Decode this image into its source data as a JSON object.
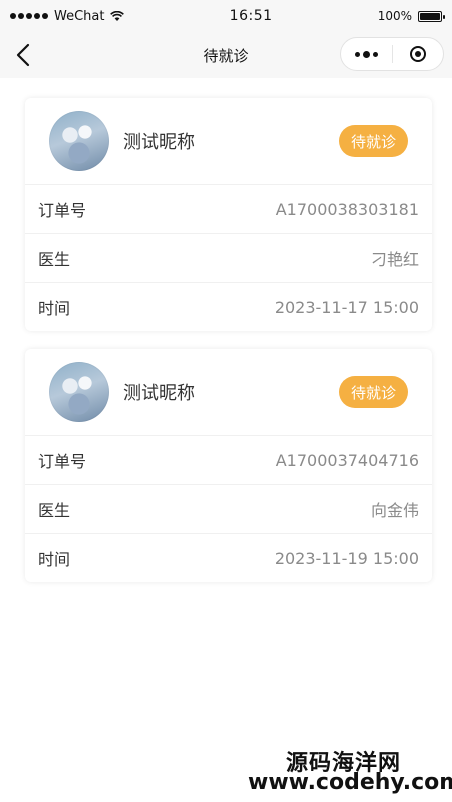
{
  "status_bar": {
    "carrier": "WeChat",
    "time": "16:51",
    "battery": "100%"
  },
  "nav": {
    "title": "待就诊"
  },
  "orders": [
    {
      "nickname": "测试昵称",
      "status": "待就诊",
      "rows": [
        {
          "label": "订单号",
          "value": "A1700038303181"
        },
        {
          "label": "医生",
          "value": "刁艳红"
        },
        {
          "label": "时间",
          "value": "2023-11-17 15:00"
        }
      ]
    },
    {
      "nickname": "测试昵称",
      "status": "待就诊",
      "rows": [
        {
          "label": "订单号",
          "value": "A1700037404716"
        },
        {
          "label": "医生",
          "value": "向金伟"
        },
        {
          "label": "时间",
          "value": "2023-11-19 15:00"
        }
      ]
    }
  ],
  "watermark": {
    "line1": "源码海洋网",
    "line2": "www.codehy.com"
  },
  "colors": {
    "badge": "#f5b042",
    "value_text": "#8a8a8a"
  }
}
